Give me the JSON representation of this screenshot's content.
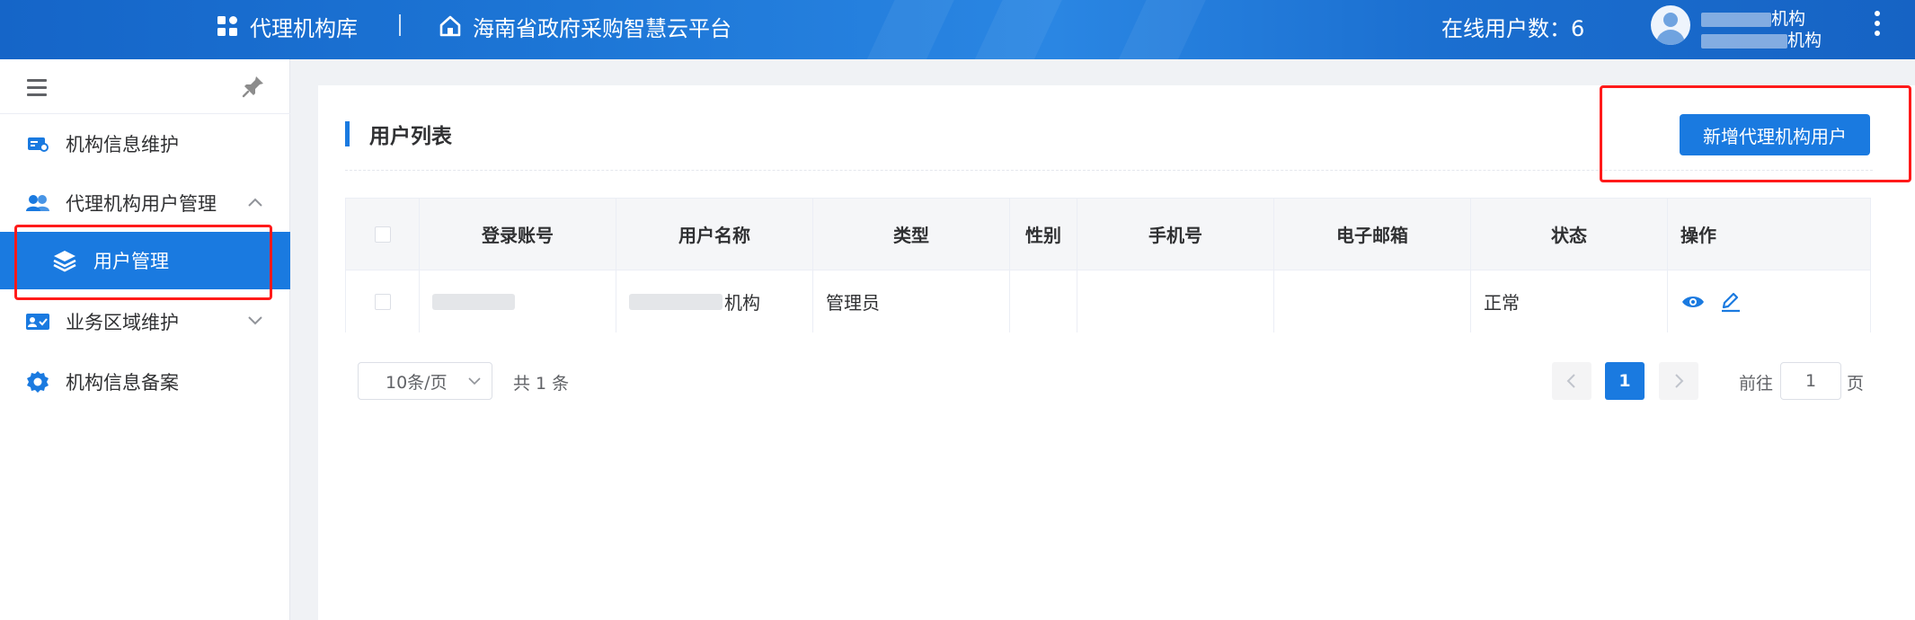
{
  "header": {
    "app_name": "代理机构库",
    "platform_name": "海南省政府采购智慧云平台",
    "online_users_label": "在线用户数：6",
    "user_line1_suffix": "机构",
    "user_line2_suffix": "机构"
  },
  "sidebar": {
    "items": [
      {
        "label": "机构信息维护",
        "icon": "id-card-icon"
      },
      {
        "label": "代理机构用户管理",
        "icon": "users-icon"
      },
      {
        "label": "用户管理",
        "icon": "layers-icon"
      },
      {
        "label": "业务区域维护",
        "icon": "region-card-icon"
      },
      {
        "label": "机构信息备案",
        "icon": "gear-icon"
      }
    ]
  },
  "main": {
    "title": "用户列表",
    "add_button_label": "新增代理机构用户",
    "table": {
      "headers": [
        "登录账号",
        "用户名称",
        "类型",
        "性别",
        "手机号",
        "电子邮箱",
        "状态",
        "操作"
      ],
      "rows": [
        {
          "login": "",
          "username_suffix": "机构",
          "type": "管理员",
          "gender": "",
          "phone": "",
          "email": "",
          "status": "正常"
        }
      ]
    },
    "pagination": {
      "page_size": "10条/页",
      "total": "共 1 条",
      "current_page": "1",
      "goto_prefix": "前往",
      "goto_value": "1",
      "goto_suffix": "页"
    }
  },
  "colors": {
    "primary": "#1a7ae0",
    "annotation": "#ff1a1a"
  }
}
